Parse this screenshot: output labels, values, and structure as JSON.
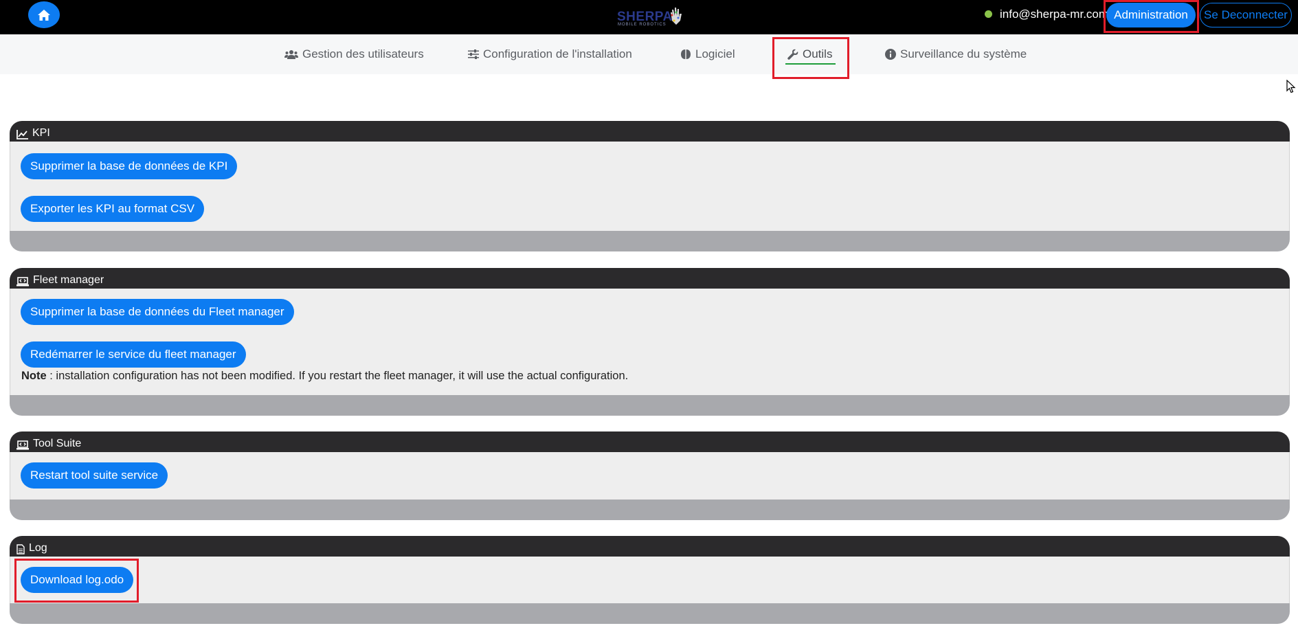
{
  "header": {
    "logo_name": "SHERPA",
    "logo_sub": "MOBILE ROBOTICS",
    "user_email": "info@sherpa-mr.com",
    "admin_label": "Administration",
    "logout_label": "Se Deconnecter",
    "status_color": "#8bc34a"
  },
  "nav": {
    "items": [
      {
        "label": "Gestion des utilisateurs",
        "icon": "users-icon"
      },
      {
        "label": "Configuration de l'installation",
        "icon": "sliders-icon"
      },
      {
        "label": "Logiciel",
        "icon": "brain-icon"
      },
      {
        "label": "Outils",
        "icon": "wrench-icon",
        "active": true
      },
      {
        "label": "Surveillance du système",
        "icon": "info-circle-icon"
      }
    ]
  },
  "panels": {
    "kpi": {
      "title": "KPI",
      "icon": "chart-line-icon",
      "buttons": [
        "Supprimer la base de données de KPI",
        "Exporter les KPI au format CSV"
      ]
    },
    "fleet": {
      "title": "Fleet manager",
      "icon": "laptop-code-icon",
      "buttons": [
        "Supprimer la base de données du Fleet manager",
        "Redémarrer le service du fleet manager"
      ],
      "note_label": "Note",
      "note_text": " : installation configuration has not been modified. If you restart the fleet manager, it will use the actual configuration."
    },
    "toolsuite": {
      "title": "Tool Suite",
      "icon": "laptop-code-icon",
      "buttons": [
        "Restart tool suite service"
      ]
    },
    "log": {
      "title": "Log",
      "icon": "file-icon",
      "buttons": [
        "Download log.odo"
      ]
    }
  },
  "colors": {
    "accent": "#0d7cf2",
    "highlight": "#e11d2a",
    "active_underline": "#1f9d3a"
  }
}
